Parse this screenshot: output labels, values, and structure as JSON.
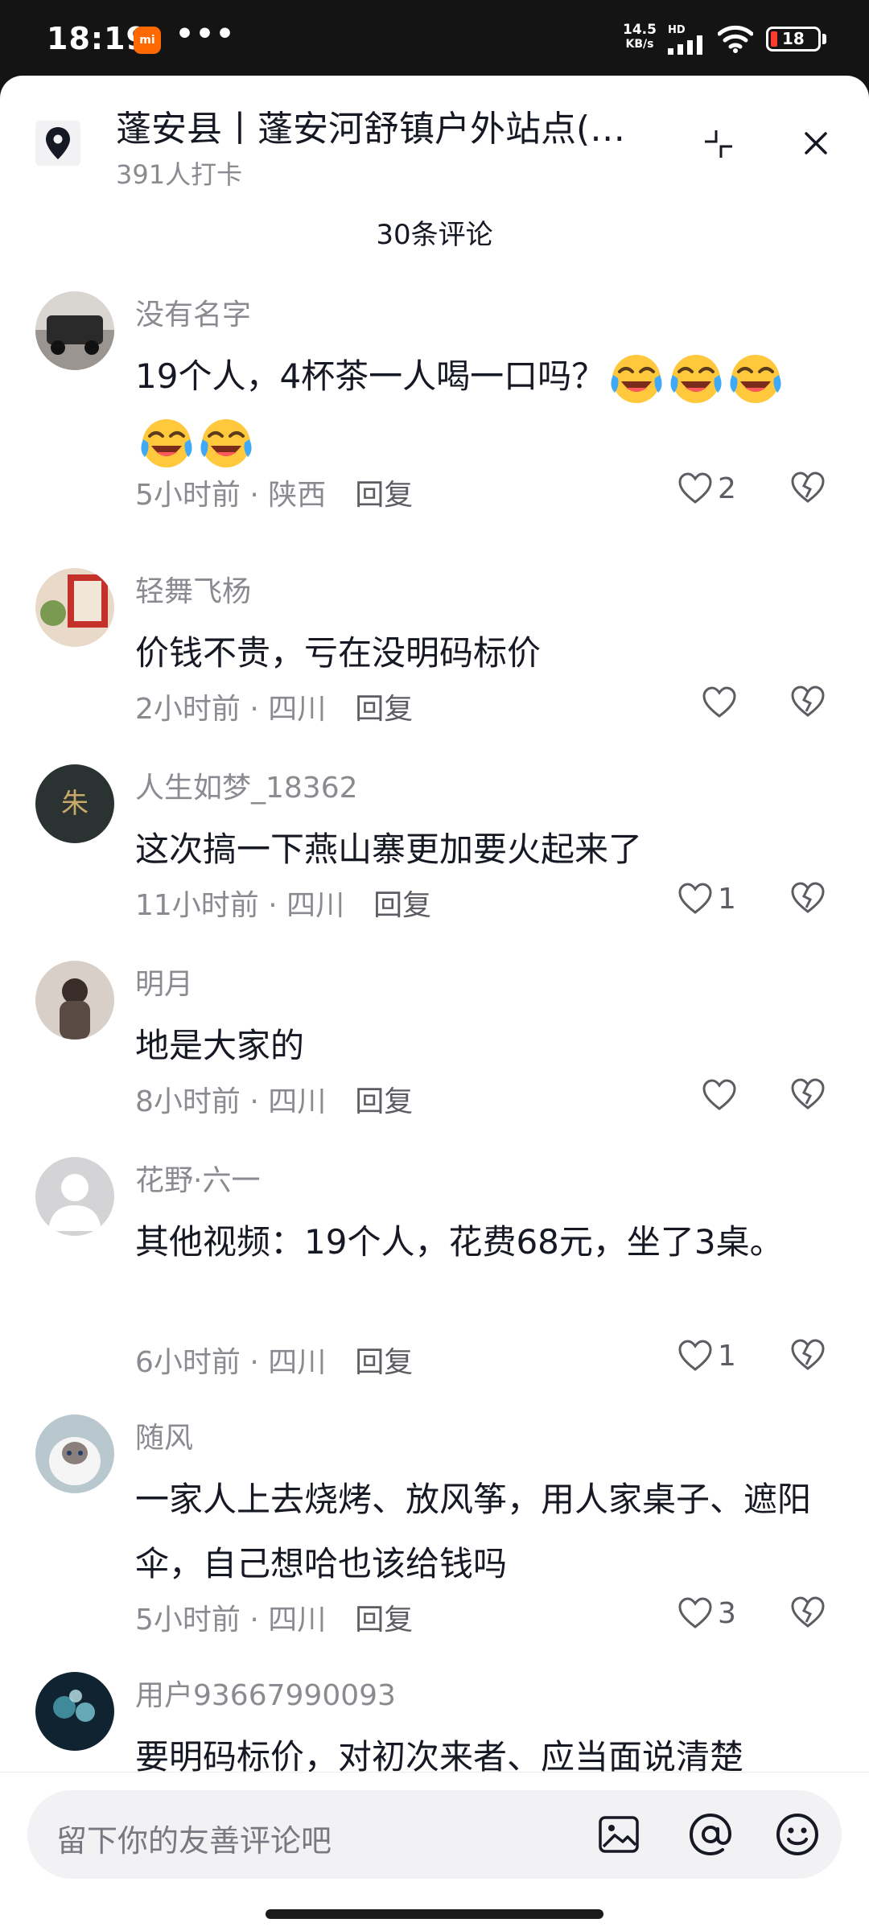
{
  "status": {
    "time": "18:19",
    "mi_badge": "mi",
    "more": "•••",
    "net_speed_value": "14.5",
    "net_speed_unit": "KB/s",
    "net_type": "HD",
    "battery": "18"
  },
  "header": {
    "location_title": "蓬安县丨蓬安河舒镇户外站点(…",
    "checkins": "391人打卡",
    "comment_count": "30条评论"
  },
  "comments": [
    {
      "user": "没有名字",
      "text": "19个人，4杯茶一人喝一口吗？",
      "emoji_count": 5,
      "time": "5小时前",
      "region": "陕西",
      "reply": "回复",
      "likes": "2"
    },
    {
      "user": "轻舞飞杨",
      "text": "价钱不贵，亏在没明码标价",
      "time": "2小时前",
      "region": "四川",
      "reply": "回复",
      "likes": ""
    },
    {
      "user": "人生如梦_18362",
      "text": "这次搞一下燕山寨更加要火起来了",
      "time": "11小时前",
      "region": "四川",
      "reply": "回复",
      "likes": "1"
    },
    {
      "user": "明月",
      "text": "地是大家的",
      "time": "8小时前",
      "region": "四川",
      "reply": "回复",
      "likes": ""
    },
    {
      "user": "花野·六一",
      "text": "其他视频：19个人，花费68元，坐了3桌。",
      "time": "6小时前",
      "region": "四川",
      "reply": "回复",
      "likes": "1"
    },
    {
      "user": "随风",
      "text": "一家人上去烧烤、放风筝，用人家桌子、遮阳伞，自己想哈也该给钱吗",
      "time": "5小时前",
      "region": "四川",
      "reply": "回复",
      "likes": "3"
    },
    {
      "user": "用户93667990093",
      "text": "要明码标价，对初次来者、应当面说清楚"
    }
  ],
  "composer": {
    "placeholder": "留下你的友善评论吧"
  },
  "icons": {
    "location": "location-pin-icon",
    "collapse": "collapse-icon",
    "close": "close-icon",
    "like": "heart-icon",
    "dislike": "broken-heart-icon",
    "image": "image-icon",
    "at": "at-icon",
    "emoji": "emoji-icon",
    "reaction": "laughing-tears-emoji"
  }
}
